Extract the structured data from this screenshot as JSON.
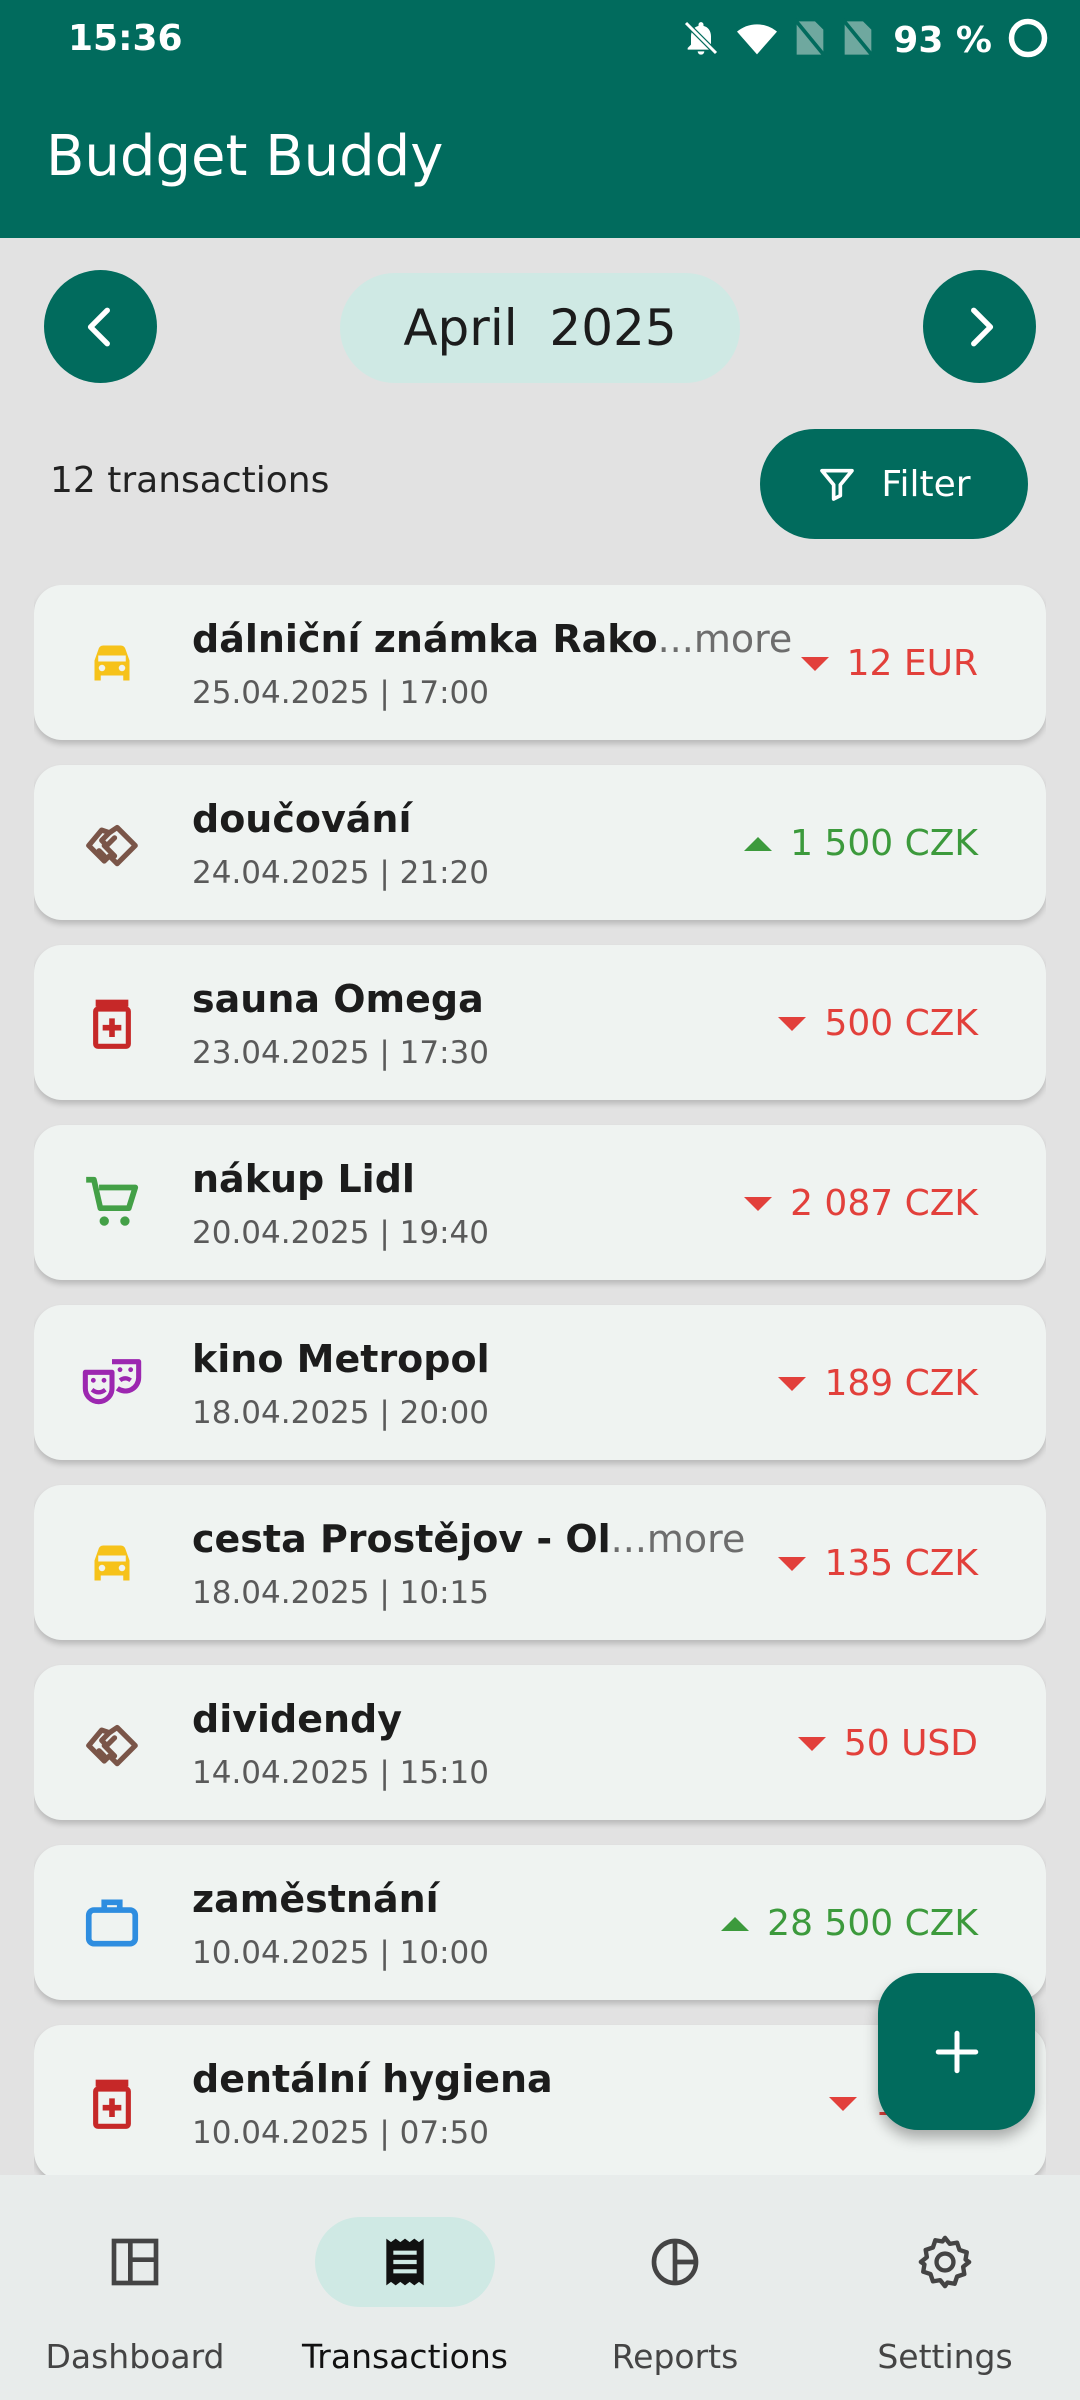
{
  "status_bar": {
    "time": "15:36",
    "battery": "93 %",
    "icons": [
      "bell-off-icon",
      "wifi-icon",
      "no-sim-icon",
      "no-sim-icon",
      "battery-ring-icon"
    ]
  },
  "app": {
    "title": "Budget Buddy"
  },
  "month_nav": {
    "label": "April  2025"
  },
  "summary": {
    "count_text": "12 transactions",
    "filter_label": "Filter"
  },
  "transactions": [
    {
      "name": "dálniční známka Rako",
      "more": "...more",
      "date": "25.04.2025 | 17:00",
      "amount": "12 EUR",
      "type": "expense",
      "icon": "car-icon",
      "color": "#f6c21a"
    },
    {
      "name": "doučování",
      "more": "",
      "date": "24.04.2025 | 21:20",
      "amount": "1 500 CZK",
      "type": "income",
      "icon": "handshake-icon",
      "color": "#7a5548"
    },
    {
      "name": "sauna Omega",
      "more": "",
      "date": "23.04.2025 | 17:30",
      "amount": "500 CZK",
      "type": "expense",
      "icon": "medicine-icon",
      "color": "#c62828"
    },
    {
      "name": "nákup Lidl",
      "more": "",
      "date": "20.04.2025 | 19:40",
      "amount": "2 087 CZK",
      "type": "expense",
      "icon": "cart-icon",
      "color": "#43a047"
    },
    {
      "name": "kino Metropol",
      "more": "",
      "date": "18.04.2025 | 20:00",
      "amount": "189 CZK",
      "type": "expense",
      "icon": "theater-icon",
      "color": "#9c27b0"
    },
    {
      "name": "cesta Prostějov - Ol",
      "more": "...more",
      "date": "18.04.2025 | 10:15",
      "amount": "135 CZK",
      "type": "expense",
      "icon": "car-icon",
      "color": "#f6c21a"
    },
    {
      "name": "dividendy",
      "more": "",
      "date": "14.04.2025 | 15:10",
      "amount": "50 USD",
      "type": "expense",
      "icon": "handshake-icon",
      "color": "#7a5548"
    },
    {
      "name": "zaměstnání",
      "more": "",
      "date": "10.04.2025 | 10:00",
      "amount": "28 500 CZK",
      "type": "income",
      "icon": "briefcase-icon",
      "color": "#2e8de0"
    },
    {
      "name": "dentální hygiena",
      "more": "",
      "date": "10.04.2025 | 07:50",
      "amount": "1 500",
      "type": "expense",
      "icon": "medicine-icon",
      "color": "#c62828"
    }
  ],
  "fab": {
    "icon": "plus-icon"
  },
  "bottom_nav": [
    {
      "label": "Dashboard",
      "icon": "dashboard-icon",
      "active": false
    },
    {
      "label": "Transactions",
      "icon": "receipt-icon",
      "active": true
    },
    {
      "label": "Reports",
      "icon": "pie-chart-icon",
      "active": false
    },
    {
      "label": "Settings",
      "icon": "gear-icon",
      "active": false
    }
  ],
  "colors": {
    "primary": "#016b5d",
    "pill": "#cfe9e4",
    "expense": "#e2403b",
    "income": "#3c9a3c",
    "card": "#eff3f1",
    "background": "#e2e2e2"
  }
}
